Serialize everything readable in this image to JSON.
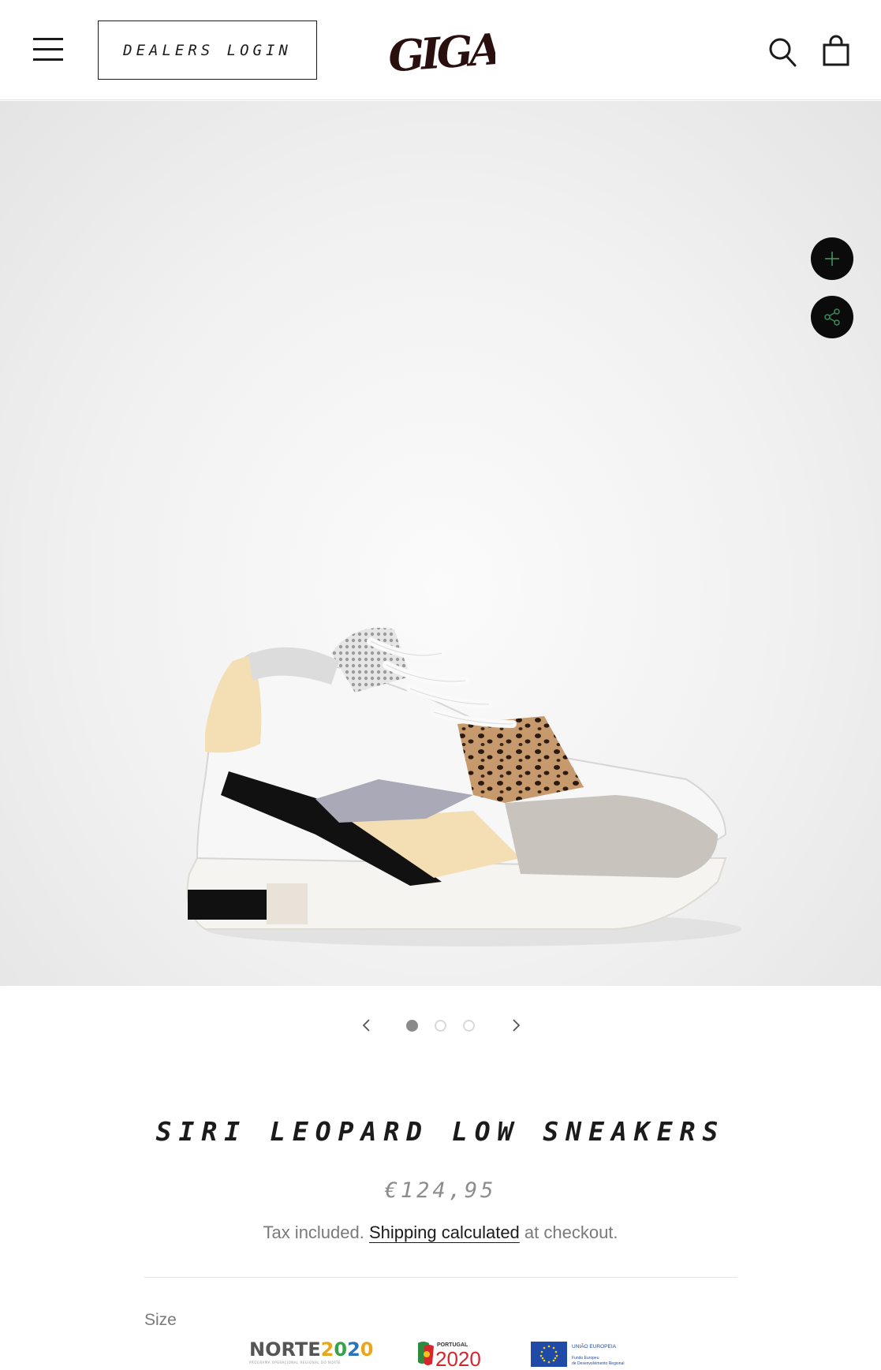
{
  "header": {
    "dealers_login_label": "DEALERS LOGIN",
    "logo_text": "GIGA",
    "icons": [
      "hamburger-menu-icon",
      "search-icon",
      "cart-icon"
    ]
  },
  "gallery": {
    "image_alt": "Siri Leopard Low Sneakers",
    "current_slide": 1,
    "total_slides": 3,
    "icons": [
      "zoom-plus-icon",
      "share-icon",
      "chevron-left-icon",
      "chevron-right-icon"
    ]
  },
  "product": {
    "title": "SIRI LEOPARD LOW SNEAKERS",
    "price": "€124,95",
    "tax_prefix": "Tax included. ",
    "shipping_link": "Shipping calculated",
    "tax_suffix": " at checkout.",
    "size_label": "Size"
  },
  "funding": {
    "norte_label": "NORTE2020",
    "portugal_label": "PORTUGAL",
    "portugal_year": "2020",
    "eu_line1": "UNIÃO EUROPEIA",
    "eu_line2": "Fundo Europeu",
    "eu_line3": "de Desenvolvimento Regional"
  },
  "colors": {
    "text": "#1c1b1b",
    "muted": "#7a7a7a",
    "price": "#8c8c8c",
    "button_dark": "#0b0b0b",
    "share_accent": "#3a8a5a"
  }
}
